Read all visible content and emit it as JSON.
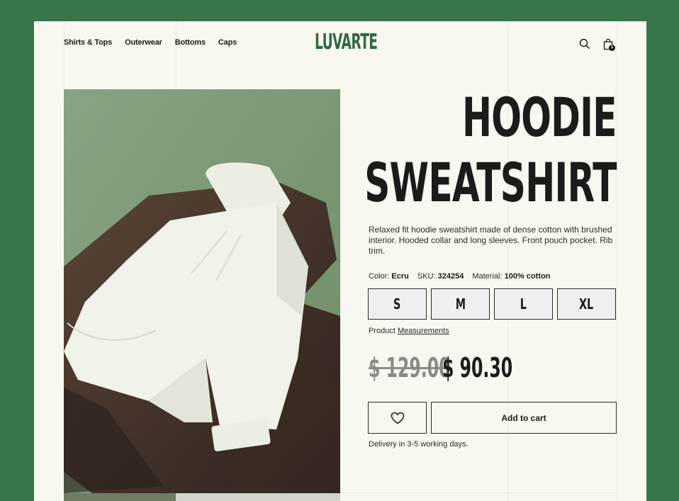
{
  "brand": {
    "logo": "LUVARTE",
    "color": "#2f6a40"
  },
  "nav": {
    "items": [
      "Shirts & Tops",
      "Outerwear",
      "Bottoms",
      "Caps"
    ]
  },
  "header": {
    "cart_count": "1",
    "icons": [
      "search-icon",
      "shopping-bag-icon"
    ]
  },
  "product": {
    "title_line1": "HOODIE",
    "title_line2": "SWEATSHIRT",
    "description": "Relaxed fit hoodie sweatshirt made of dense cotton with brushed interior. Hooded collar and long sleeves. Front pouch pocket. Rib trim.",
    "color_label": "Color:",
    "color_value": "Ecru",
    "sku_label": "SKU:",
    "sku_value": "324254",
    "material_label": "Material:",
    "material_value": "100% cotton",
    "sizes": [
      "S",
      "M",
      "L",
      "XL"
    ],
    "measure_prefix": "Product",
    "measure_link": "Measurements",
    "price_old": "$ 129.00",
    "price_new": "$ 90.30",
    "add_to_cart": "Add to cart",
    "delivery": "Delivery in 3-5 working days."
  },
  "colors": {
    "background": "#37754a",
    "page": "#f8f8f1",
    "text": "#1b1b19"
  }
}
